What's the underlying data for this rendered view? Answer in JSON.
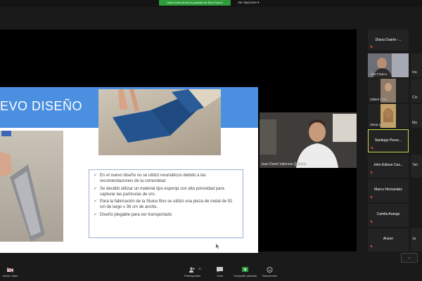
{
  "banner": {
    "text": "Usted está viendo la pantalla de Álex Franco"
  },
  "view_options": {
    "label": "Ver Opciones",
    "chevron": "▾"
  },
  "slide": {
    "title": "EVO DISEÑO",
    "bullets": [
      "En el nuevo diseño no se utilizó neumáticos debido a las recomendaciones de la comunidad.",
      "Se decidió utilizar un material tipo esponja con alta porosidad para capturar las partículas de oro.",
      "Para la fabricación de la Sluice Box se utilizó una pieza de metal de 92 cm de largo x 36 cm de ancho.",
      "Diseño plegable para ser transportado"
    ],
    "check_icon": "✓"
  },
  "main_video": {
    "name": "Juan David Valencia Quesno"
  },
  "participants": [
    {
      "name": "Diana Duarte -...",
      "video": false
    },
    {
      "name": "Alex Franco",
      "video": true
    },
    {
      "name": "Gilbert Trillo...",
      "video": true
    },
    {
      "name": "Olivia Quip...",
      "video": true
    },
    {
      "name": "Santiago Perez...",
      "video": false,
      "active": true
    },
    {
      "name": "John Edison Cas...",
      "video": false
    },
    {
      "name": "Marco Hernandez",
      "video": false
    },
    {
      "name": "Camila Arango",
      "video": false
    },
    {
      "name": "Anson",
      "video": false
    }
  ],
  "partial_names": [
    "Isa",
    "Cin",
    "Ma",
    "Tati",
    "Ja"
  ],
  "toolbar": {
    "start_video": "Iniciar video",
    "participants": "Participantes",
    "participants_count": "27",
    "chat": "Chat",
    "share_screen": "Compartir pantalla",
    "reactions": "Reacciones"
  },
  "colors": {
    "accent_green": "#2e9c3a",
    "slide_blue": "#4a8fe0",
    "active_border": "#c9d44a",
    "muted_red": "#e23c3c"
  },
  "icons": {
    "scroll_down": "⌄"
  }
}
